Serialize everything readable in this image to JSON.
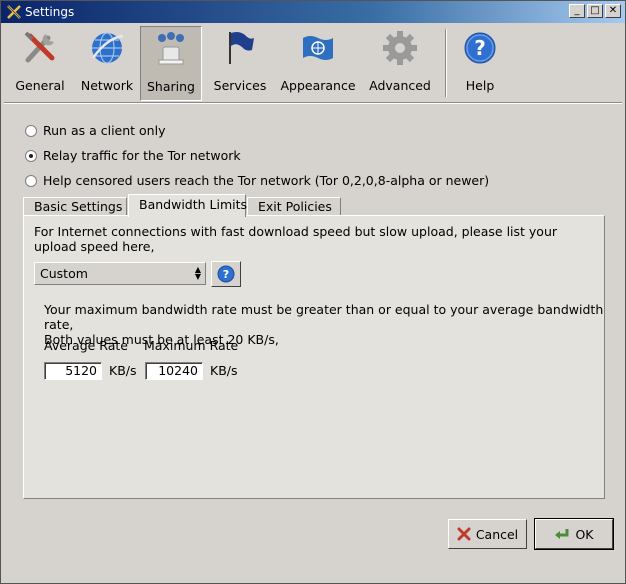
{
  "window": {
    "title": "Settings"
  },
  "toolbar": {
    "items": [
      {
        "label": "General",
        "icon": "tools-icon"
      },
      {
        "label": "Network",
        "icon": "globe-icon"
      },
      {
        "label": "Sharing",
        "icon": "sharing-icon",
        "active": true
      },
      {
        "label": "Services",
        "icon": "flag-icon"
      },
      {
        "label": "Appearance",
        "icon": "un-flag-icon"
      },
      {
        "label": "Advanced",
        "icon": "gear-icon"
      },
      {
        "label": "Help",
        "icon": "help-icon"
      }
    ]
  },
  "sharing": {
    "options": [
      {
        "label": "Run as a client only",
        "selected": false
      },
      {
        "label": "Relay traffic for the Tor network",
        "selected": true
      },
      {
        "label": "Help censored users reach the Tor network (Tor 0,2,0,8-alpha or newer)",
        "selected": false
      }
    ]
  },
  "tabs": [
    {
      "label": "Basic Settings"
    },
    {
      "label": "Bandwidth Limits",
      "active": true
    },
    {
      "label": "Exit Policies"
    }
  ],
  "bandwidth": {
    "description": "For Internet connections with fast download speed but slow upload, please list your upload speed here,",
    "preset_value": "Custom",
    "note_line1": "Your maximum bandwidth rate must be greater than or equal to your average bandwidth rate,",
    "note_line2": "Both values must be at least 20 KB/s,",
    "average_label": "Average Rate",
    "maximum_label": "Maximum Rate",
    "average_value": "5120",
    "maximum_value": "10240",
    "unit": "KB/s"
  },
  "buttons": {
    "cancel": "Cancel",
    "ok": "OK"
  },
  "colors": {
    "titlebar": "#0a246a",
    "window_bg": "#d6d3ce",
    "panel_bg": "#e4e2dd"
  }
}
